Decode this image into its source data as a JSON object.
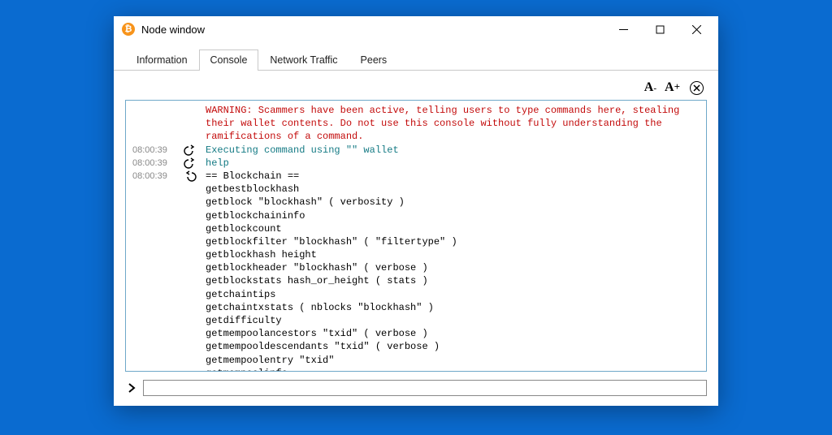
{
  "window": {
    "title": "Node window"
  },
  "tabs": [
    {
      "label": "Information"
    },
    {
      "label": "Console"
    },
    {
      "label": "Network Traffic"
    },
    {
      "label": "Peers"
    }
  ],
  "active_tab": 1,
  "toolbar": {
    "font_decrease_label": "A-",
    "font_increase_label": "A+"
  },
  "console": {
    "lines": [
      {
        "ts": "",
        "dir": "",
        "cls": "red",
        "text": "WARNING: Scammers have been active, telling users to type commands here, stealing their wallet contents. Do not use this console without fully understanding the ramifications of a command."
      },
      {
        "ts": "08:00:39",
        "dir": "out",
        "cls": "teal",
        "text": "Executing command using \"\" wallet"
      },
      {
        "ts": "08:00:39",
        "dir": "out",
        "cls": "teal",
        "text": "help"
      },
      {
        "ts": "08:00:39",
        "dir": "in",
        "cls": "black",
        "text": "== Blockchain ==\ngetbestblockhash\ngetblock \"blockhash\" ( verbosity )\ngetblockchaininfo\ngetblockcount\ngetblockfilter \"blockhash\" ( \"filtertype\" )\ngetblockhash height\ngetblockheader \"blockhash\" ( verbose )\ngetblockstats hash_or_height ( stats )\ngetchaintips\ngetchaintxstats ( nblocks \"blockhash\" )\ngetdifficulty\ngetmempoolancestors \"txid\" ( verbose )\ngetmempooldescendants \"txid\" ( verbose )\ngetmempoolentry \"txid\"\ngetmempoolinfo"
      }
    ],
    "input_value": ""
  }
}
